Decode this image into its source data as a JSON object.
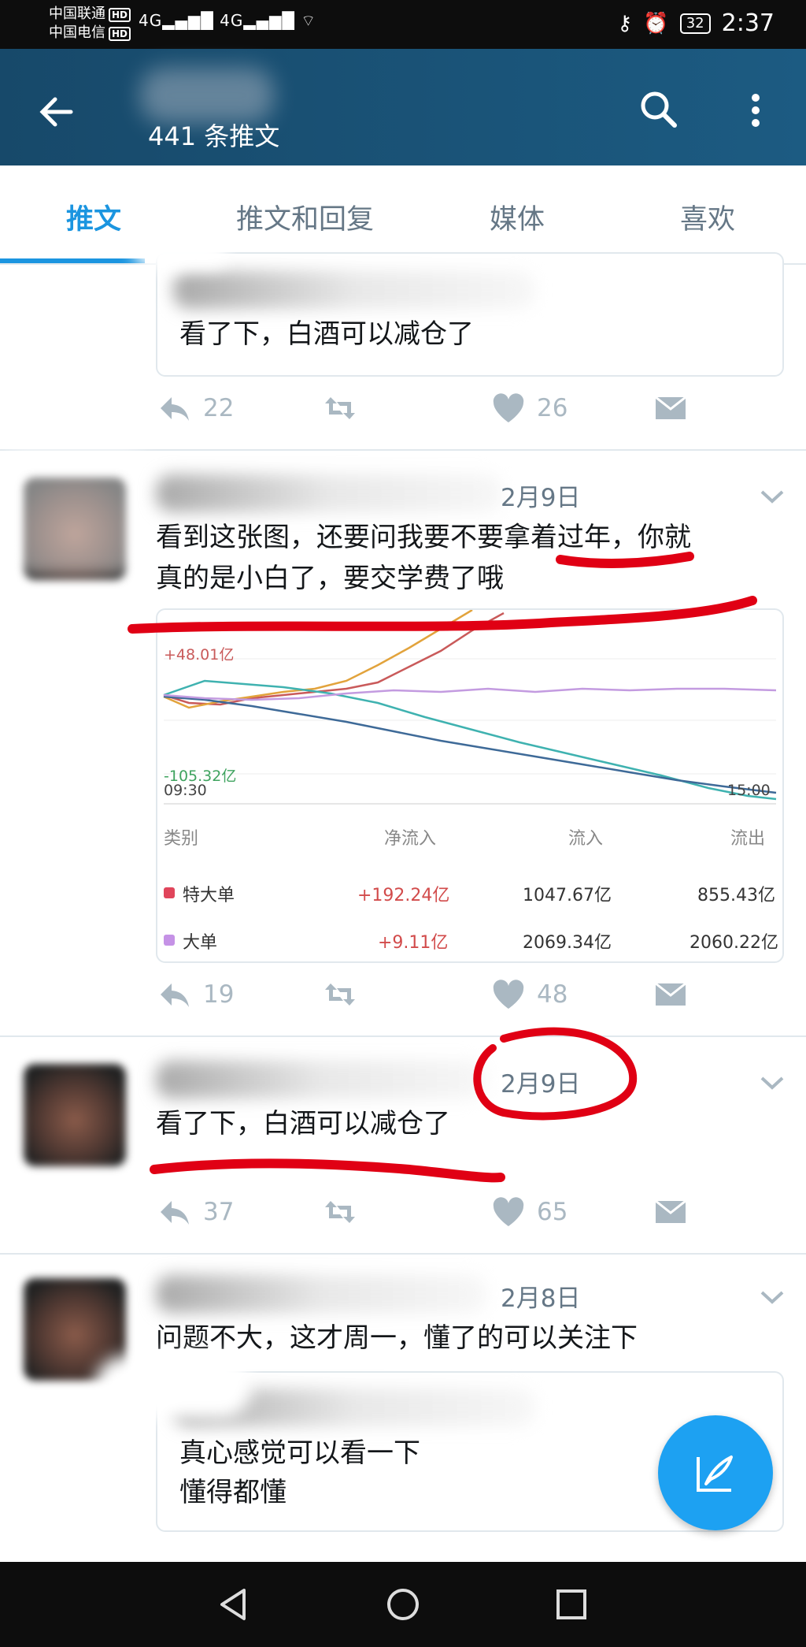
{
  "status_bar": {
    "carrier1": "中国联通",
    "carrier2": "中国电信",
    "hd": "HD",
    "signal1": "4G",
    "signal2": "4G",
    "battery": "32",
    "time": "2:37"
  },
  "app_bar": {
    "subtitle": "441 条推文"
  },
  "tabs": [
    {
      "label": "推文"
    },
    {
      "label": "推文和回复"
    },
    {
      "label": "媒体"
    },
    {
      "label": "喜欢"
    }
  ],
  "tweets": [
    {
      "quoted_text": "看了下，白酒可以减仓了",
      "replies": "22",
      "likes": "26"
    },
    {
      "date": "2月9日",
      "text_line1": "看到这张图，还要问我要不要拿着过年，你就",
      "text_line2": "真的是小白了，要交学费了哦",
      "chart": {
        "top_value": "+48.01亿",
        "bottom_value": "-105.32亿",
        "start_time": "09:30",
        "end_time": "15:00",
        "headers": [
          "类别",
          "净流入",
          "流入",
          "流出"
        ],
        "rows": [
          {
            "color": "#e0455b",
            "name": "特大单",
            "net": "+192.24亿",
            "in": "1047.67亿",
            "out": "855.43亿"
          },
          {
            "color": "#c592e6",
            "name": "大单",
            "net": "+9.11亿",
            "in": "2069.34亿",
            "out": "2060.22亿"
          }
        ]
      },
      "replies": "19",
      "likes": "48"
    },
    {
      "date": "2月9日",
      "text": "看了下，白酒可以减仓了",
      "replies": "37",
      "likes": "65"
    },
    {
      "date": "2月8日",
      "text": "问题不大，这才周一，懂了的可以关注下",
      "quoted_line1": "真心感觉可以看一下",
      "quoted_line2": "懂得都懂"
    }
  ],
  "colors": {
    "accent": "#1b95e0",
    "app_bar": "#1c5b82",
    "fab": "#1da1f2",
    "annotation_red": "#e00014"
  }
}
